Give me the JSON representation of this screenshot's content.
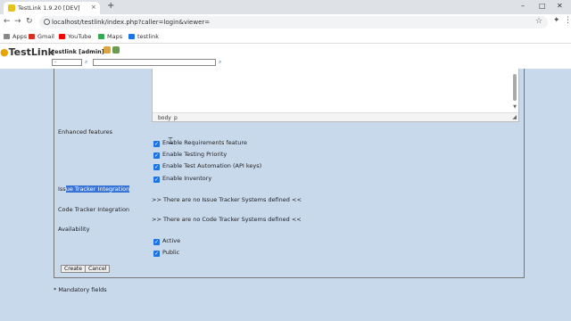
{
  "browser": {
    "tab_title": "TestLink 1.9.20 [DEV]",
    "tab_close": "×",
    "new_tab": "+",
    "url": "localhost/testlink/index.php?caller=login&viewer=",
    "win_min": "–",
    "win_max": "□",
    "win_close": "✕",
    "bookmarks": [
      {
        "label": "Apps",
        "color": "#888888"
      },
      {
        "label": "Gmail",
        "color": "#d93025"
      },
      {
        "label": "YouTube",
        "color": "#ff0000"
      },
      {
        "label": "Maps",
        "color": "#34a853"
      },
      {
        "label": "testlink",
        "color": "#1a73e8"
      }
    ]
  },
  "header": {
    "logo_text": "TestLink",
    "user_label": "testlink [admin]",
    "selector_value": "-"
  },
  "editor": {
    "path_items": [
      "body",
      "p"
    ]
  },
  "form": {
    "enhanced_features_label": "Enhanced features",
    "checkboxes": [
      "Enable Requirements feature",
      "Enable Testing Priority",
      "Enable Test Automation (API keys)",
      "Enable Inventory"
    ],
    "issue_tracker_label_plain": "Iss",
    "issue_tracker_label_selected": "ue Tracker Integration",
    "issue_tracker_msg": ">> There are no Issue Tracker Systems defined <<",
    "code_tracker_label": "Code Tracker Integration",
    "code_tracker_msg": ">> There are no Code Tracker Systems defined <<",
    "availability_label": "Availability",
    "availability": [
      "Active",
      "Public"
    ],
    "create_button": "Create",
    "cancel_button": "Cancel",
    "mandatory_note": "* Mandatory fields"
  },
  "colors": {
    "content_bg": "#c9d9ec",
    "checkbox_accent": "#1a73e8",
    "selection_bg": "#3875d7"
  }
}
